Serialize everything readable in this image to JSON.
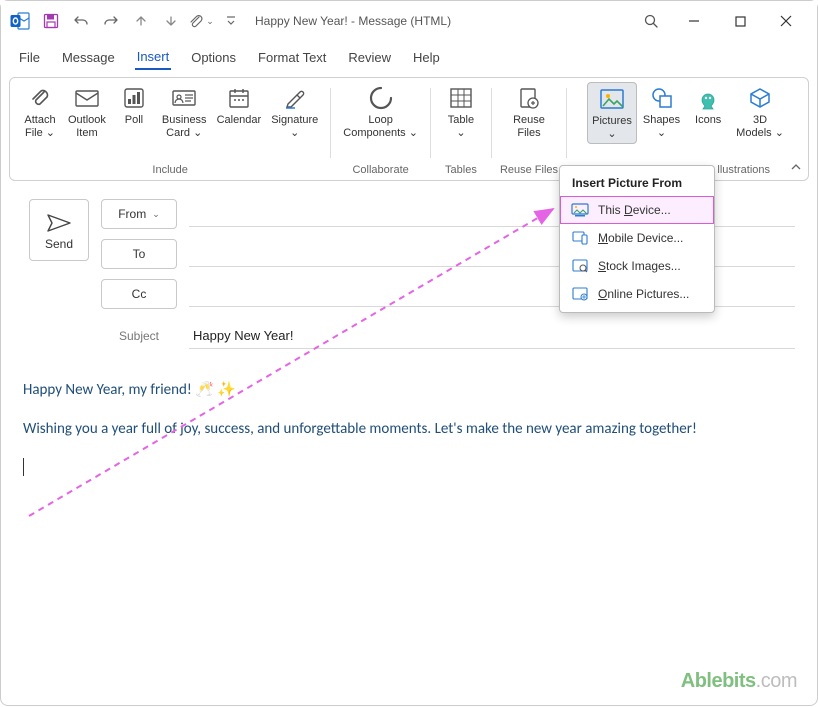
{
  "titlebar": {
    "title": "Happy New Year!  -  Message (HTML)"
  },
  "menutabs": {
    "file": "File",
    "message": "Message",
    "insert": "Insert",
    "options": "Options",
    "format_text": "Format Text",
    "review": "Review",
    "help": "Help"
  },
  "ribbon": {
    "attach_file": "Attach\nFile ⌄",
    "outlook_item": "Outlook\nItem",
    "poll": "Poll",
    "business_card": "Business\nCard ⌄",
    "calendar": "Calendar",
    "signature": "Signature\n⌄",
    "group_include": "Include",
    "loop": "Loop\nComponents ⌄",
    "group_collaborate": "Collaborate",
    "table": "Table\n⌄",
    "group_tables": "Tables",
    "reuse_files": "Reuse\nFiles",
    "group_reuse": "Reuse Files",
    "pictures": "Pictures\n⌄",
    "shapes": "Shapes\n⌄",
    "icons": "Icons",
    "models": "3D\nModels ⌄",
    "group_illustrations": "llustrations"
  },
  "compose": {
    "send": "Send",
    "from": "From",
    "to": "To",
    "cc": "Cc",
    "subject_label": "Subject",
    "subject_value": "Happy New Year!"
  },
  "body": {
    "line1": "Happy New Year, my friend! 🥂 ✨",
    "line2": "Wishing you a year full of joy, success, and unforgettable moments. Let's make the new year amazing together!"
  },
  "dropdown": {
    "title": "Insert Picture From",
    "this_device_pre": "This ",
    "this_device_u": "D",
    "this_device_post": "evice...",
    "mobile_pre": "",
    "mobile_u": "M",
    "mobile_post": "obile Device...",
    "stock_pre": "",
    "stock_u": "S",
    "stock_post": "tock Images...",
    "online_pre": "",
    "online_u": "O",
    "online_post": "nline Pictures..."
  },
  "watermark": {
    "brand": "Ablebits",
    "suffix": ".com"
  }
}
